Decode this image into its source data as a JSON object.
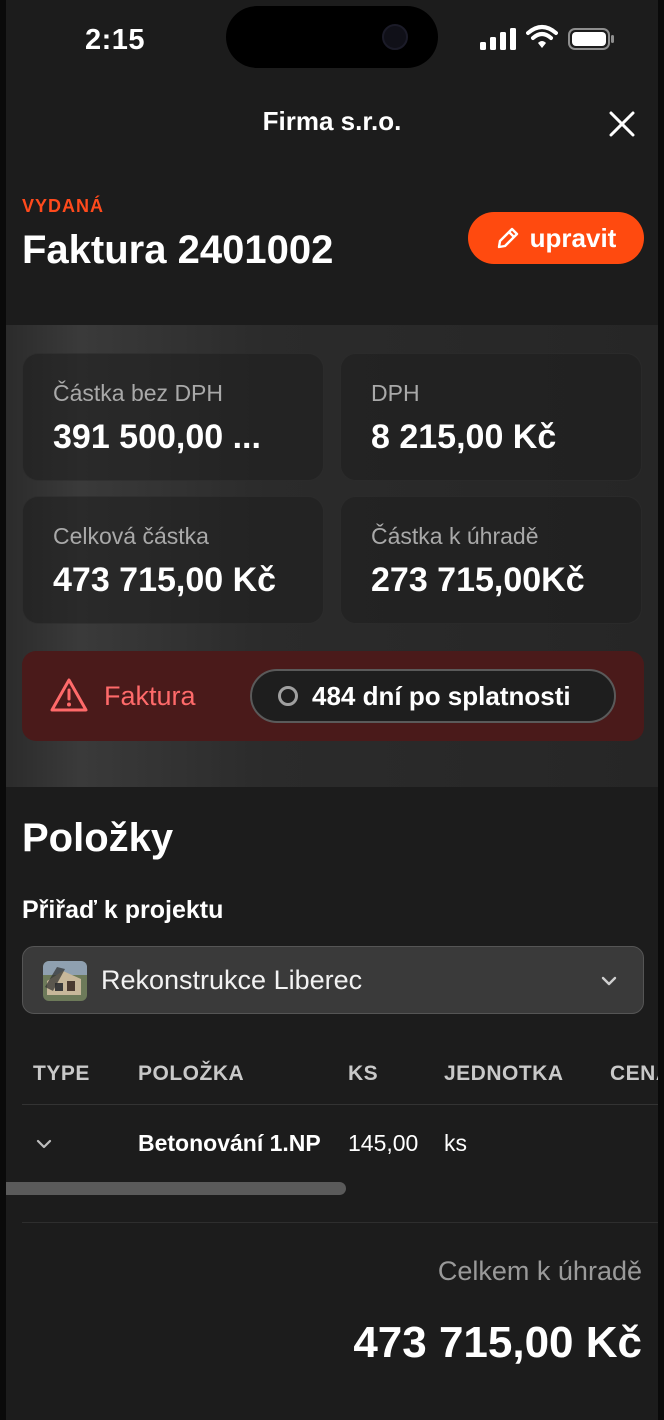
{
  "status_bar": {
    "time": "2:15"
  },
  "header": {
    "title": "Firma s.r.o."
  },
  "invoice": {
    "kicker": "VYDANÁ",
    "title": "Faktura 2401002",
    "edit_label": "upravit"
  },
  "summary": {
    "cards": [
      {
        "label": "Částka bez DPH",
        "value": "391 500,00 ..."
      },
      {
        "label": "DPH",
        "value": "8 215,00 Kč"
      },
      {
        "label": "Celková částka",
        "value": "473 715,00 Kč"
      },
      {
        "label": "Částka k úhradě",
        "value": "273 715,00Kč"
      }
    ],
    "alert": {
      "label": "Faktura",
      "status": "484 dní po splatnosti"
    }
  },
  "items": {
    "title": "Položky",
    "assign_label": "Přiřaď k projektu",
    "project": "Rekonstrukce Liberec",
    "columns": [
      "TYPE",
      "POLOŽKA",
      "KS",
      "JEDNOTKA",
      "CENA"
    ],
    "rows": [
      {
        "item": "Betonování 1.NP",
        "qty": "145,00",
        "unit": "ks"
      }
    ]
  },
  "total": {
    "label": "Celkem k úhradě",
    "value": "473 715,00 Kč"
  },
  "colors": {
    "accent": "#ff4a0f",
    "danger": "#ff6a6a",
    "alert_bg": "#4a1a1a",
    "background": "#1c1c1c"
  }
}
